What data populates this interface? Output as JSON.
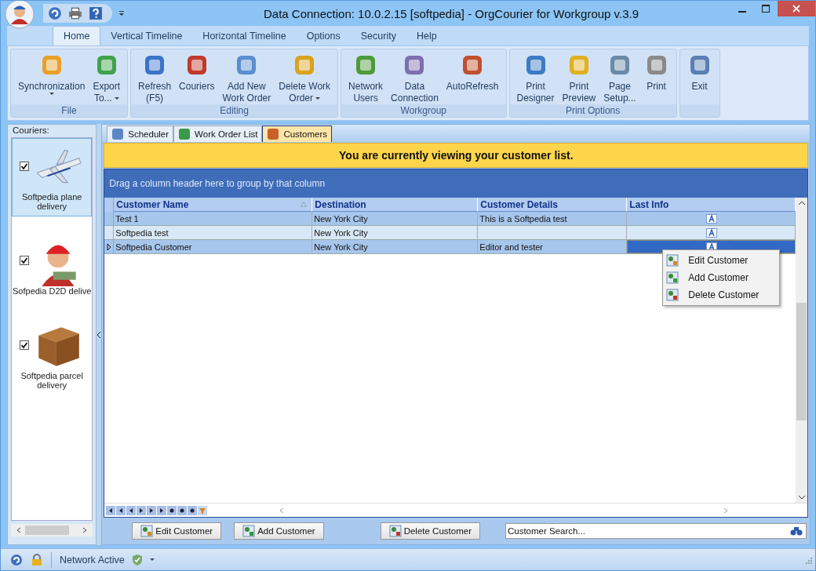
{
  "window": {
    "title": "Data Connection: 10.0.2.15 [softpedia] - OrgCourier for Workgroup v.3.9"
  },
  "menu_tabs": [
    {
      "label": "Home",
      "selected": true
    },
    {
      "label": "Vertical Timeline",
      "selected": false
    },
    {
      "label": "Horizontal Timeline",
      "selected": false
    },
    {
      "label": "Options",
      "selected": false
    },
    {
      "label": "Security",
      "selected": false
    },
    {
      "label": "Help",
      "selected": false
    }
  ],
  "ribbon_groups": [
    {
      "label": "File",
      "buttons": [
        {
          "lines": [
            "Synchronization"
          ],
          "dropdown": true
        },
        {
          "lines": [
            "Export",
            "To..."
          ],
          "dropdown": true
        }
      ]
    },
    {
      "label": "Editing",
      "buttons": [
        {
          "lines": [
            "Refresh",
            "(F5)"
          ],
          "dropdown": false
        },
        {
          "lines": [
            "Couriers"
          ],
          "dropdown": false
        },
        {
          "lines": [
            "Add New",
            "Work Order"
          ],
          "dropdown": false
        },
        {
          "lines": [
            "Delete Work",
            "Order"
          ],
          "dropdown": true
        }
      ]
    },
    {
      "label": "Workgroup",
      "buttons": [
        {
          "lines": [
            "Network",
            "Users"
          ],
          "dropdown": false
        },
        {
          "lines": [
            "Data",
            "Connection"
          ],
          "dropdown": false
        },
        {
          "lines": [
            "AutoRefresh"
          ],
          "dropdown": false
        }
      ]
    },
    {
      "label": "Print Options",
      "buttons": [
        {
          "lines": [
            "Print",
            "Designer"
          ],
          "dropdown": false
        },
        {
          "lines": [
            "Print",
            "Preview"
          ],
          "dropdown": false
        },
        {
          "lines": [
            "Page",
            "Setup..."
          ],
          "dropdown": false
        },
        {
          "lines": [
            "Print"
          ],
          "dropdown": false
        }
      ]
    },
    {
      "buttons": [
        {
          "lines": [
            "Exit"
          ],
          "dropdown": false
        }
      ]
    }
  ],
  "sidebar": {
    "title": "Couriers:",
    "couriers": [
      {
        "lines": [
          "Softpedia plane",
          "delivery"
        ],
        "checked": true,
        "selected": true
      },
      {
        "lines": [
          "Sofpedia D2D delive"
        ],
        "checked": true,
        "selected": false
      },
      {
        "lines": [
          "Softpedia parcel",
          "delivery"
        ],
        "checked": true,
        "selected": false
      }
    ]
  },
  "content_tabs": [
    {
      "label": "Scheduler",
      "selected": false
    },
    {
      "label": "Work Order List",
      "selected": false
    },
    {
      "label": "Customers",
      "selected": true
    }
  ],
  "banner": "You are currently viewing your customer list.",
  "table": {
    "group_hint": "Drag a column header here to group by that column",
    "columns": [
      {
        "label": "Customer Name",
        "sorted": true
      },
      {
        "label": "Destination",
        "sorted": false
      },
      {
        "label": "Customer Details",
        "sorted": false
      },
      {
        "label": "Last Info",
        "sorted": false
      }
    ],
    "rows": [
      {
        "cells": [
          "Test 1",
          "New York City",
          "This is a Softpedia test"
        ],
        "selected": false
      },
      {
        "cells": [
          "Softpedia test",
          "New York City",
          ""
        ],
        "selected": false
      },
      {
        "cells": [
          "Softpedia Customer",
          "New York City",
          "Editor and tester"
        ],
        "selected": true
      }
    ]
  },
  "context_menu": [
    "Edit Customer",
    "Add Customer",
    "Delete Customer"
  ],
  "action_buttons": [
    "Edit Customer",
    "Add Customer",
    "Delete Customer"
  ],
  "search": {
    "placeholder": "Customer Search..."
  },
  "status_bar": {
    "network": "Network Active"
  }
}
